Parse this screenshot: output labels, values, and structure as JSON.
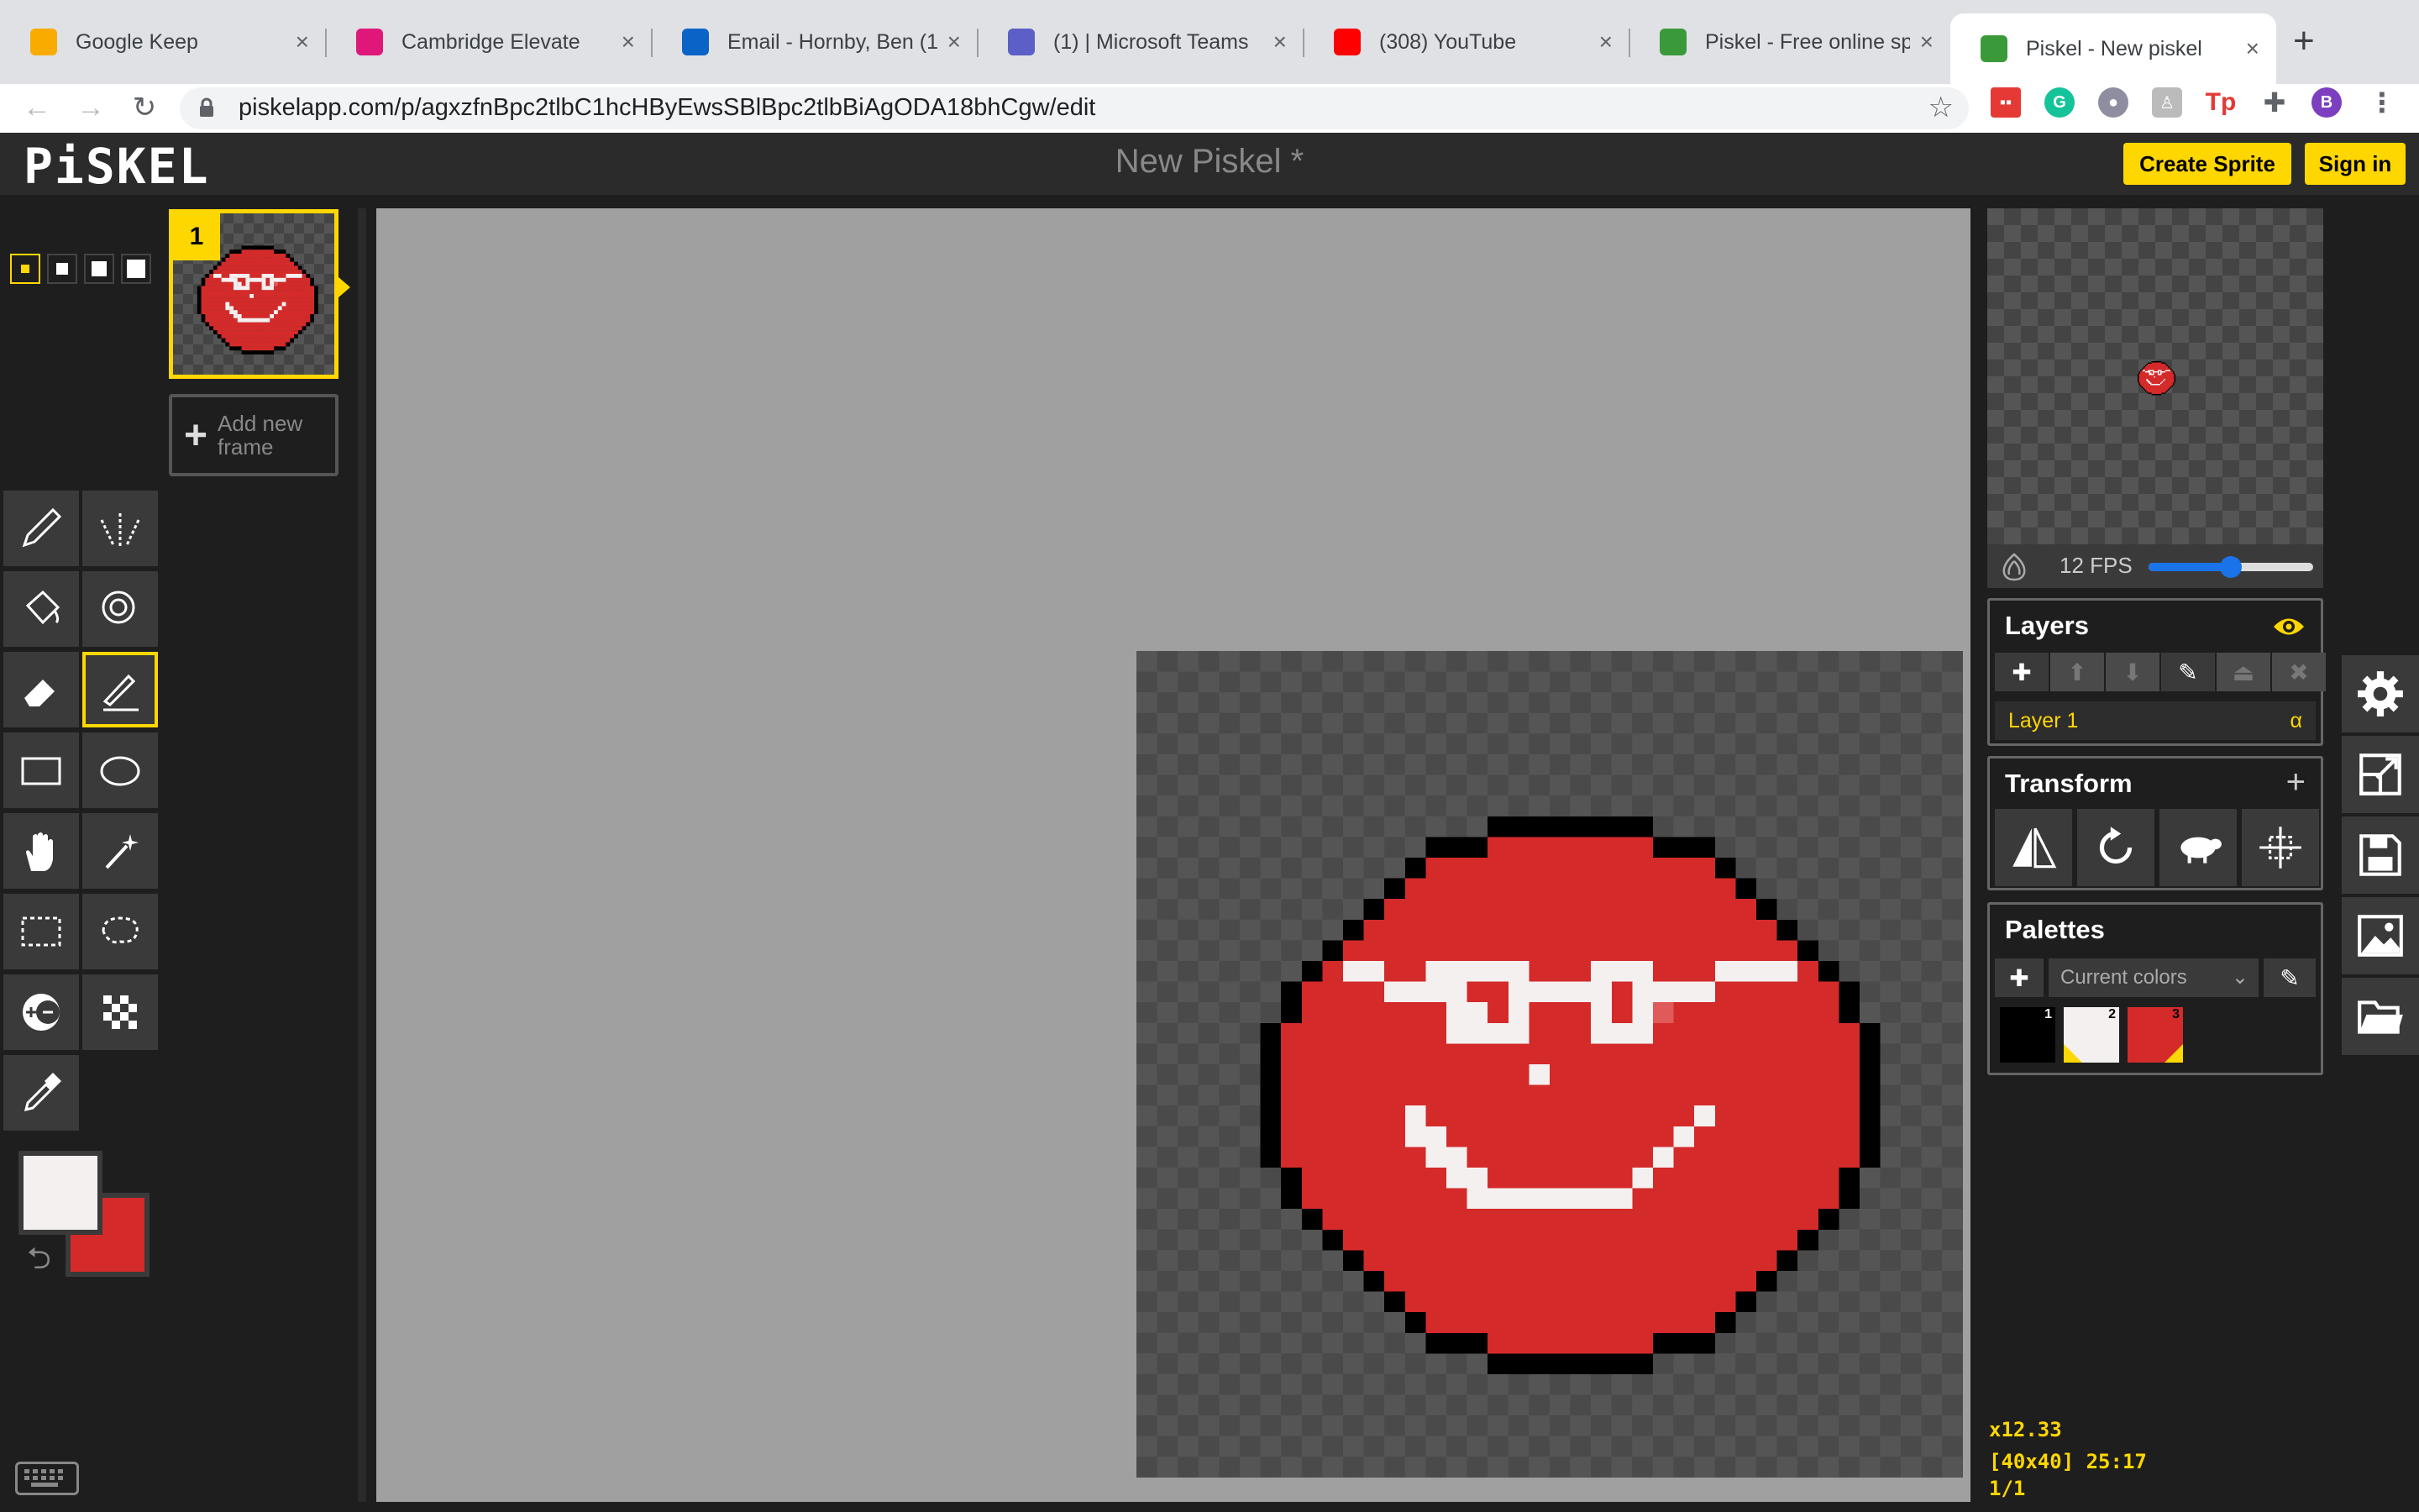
{
  "browser": {
    "tabs": [
      {
        "label": "Google Keep",
        "favicon": "google-keep-icon",
        "color": "#f9ab00"
      },
      {
        "label": "Cambridge Elevate",
        "favicon": "cambridge-elevate-icon",
        "color": "#e0177a"
      },
      {
        "label": "Email - Hornby, Ben (1",
        "favicon": "outlook-icon",
        "color": "#0a64c8"
      },
      {
        "label": "(1) | Microsoft Teams",
        "favicon": "teams-icon",
        "color": "#5b5fc7"
      },
      {
        "label": "(308) YouTube",
        "favicon": "youtube-icon",
        "color": "#ff0000"
      },
      {
        "label": "Piskel - Free online sp",
        "favicon": "piskel-icon",
        "color": "#3a9a3a"
      },
      {
        "label": "Piskel - New piskel",
        "favicon": "piskel-icon",
        "color": "#3a9a3a",
        "active": true
      }
    ],
    "close_glyph": "×",
    "new_tab_glyph": "+",
    "url": "piskelapp.com/p/agxzfnBpc2tlbC1hcHByEwsSBlBpc2tlbBiAgODA18bhCgw/edit",
    "profile_initial": "B"
  },
  "app": {
    "logo": "PiSKEL",
    "title": "New Piskel *",
    "create_sprite": "Create Sprite",
    "sign_in": "Sign in",
    "accent": "#ffd700"
  },
  "frames": {
    "frame_number": "1",
    "add_frame_label": "Add new frame"
  },
  "preview": {
    "fps_label": "12 FPS",
    "fps_fraction": 0.5
  },
  "layers": {
    "title": "Layers",
    "items": [
      {
        "name": "Layer 1",
        "alpha": "α"
      }
    ]
  },
  "transform": {
    "title": "Transform"
  },
  "palettes": {
    "title": "Palettes",
    "selected": "Current colors",
    "colors": [
      {
        "num": "1",
        "hex": "#000000"
      },
      {
        "num": "2",
        "hex": "#f5f0f0"
      },
      {
        "num": "3",
        "hex": "#d42a2a"
      }
    ]
  },
  "colors": {
    "primary": "#f5f0f0",
    "secondary": "#d42a2a"
  },
  "status": {
    "zoom": "x12.33",
    "cursor": "[40x40] 25:17",
    "frames": "1/1"
  }
}
